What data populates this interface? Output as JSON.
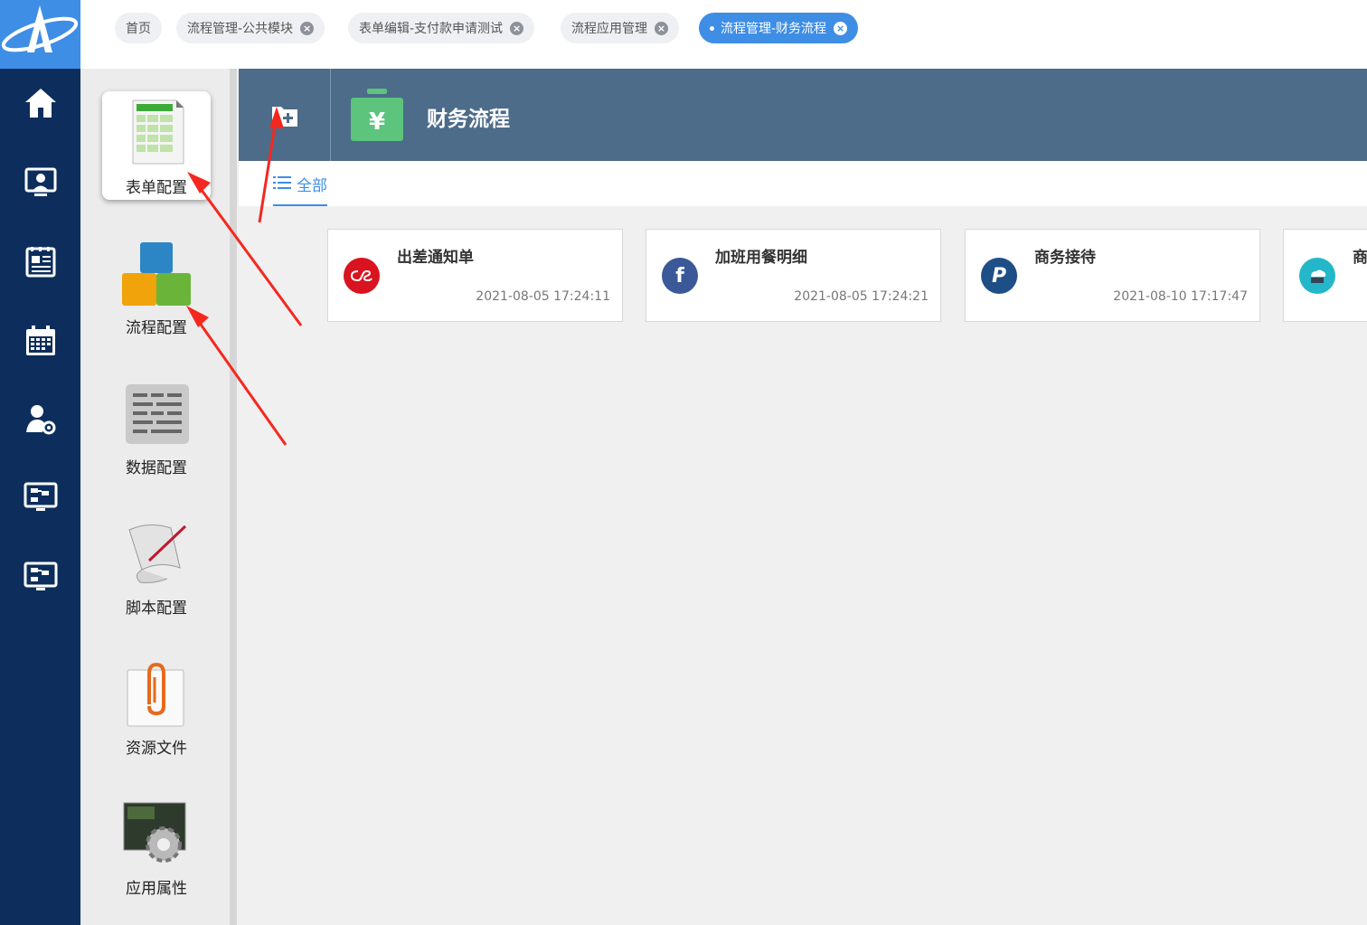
{
  "tabs": [
    {
      "label": "首页",
      "closable": false
    },
    {
      "label": "流程管理-公共模块",
      "closable": true
    },
    {
      "label": "表单编辑-支付款申请测试",
      "closable": true
    },
    {
      "label": "流程应用管理",
      "closable": true
    },
    {
      "label": "流程管理-财务流程",
      "closable": true,
      "active": true
    }
  ],
  "nav_icons": [
    "home-icon",
    "user-screen-icon",
    "newspaper-icon",
    "calendar-icon",
    "user-settings-icon",
    "monitor-flow-icon",
    "monitor-flow-icon"
  ],
  "config_items": [
    {
      "label": "表单配置",
      "icon": "form-sheet-icon",
      "active": true
    },
    {
      "label": "流程配置",
      "icon": "blocks-icon"
    },
    {
      "label": "数据配置",
      "icon": "data-list-icon"
    },
    {
      "label": "脚本配置",
      "icon": "script-scroll-icon"
    },
    {
      "label": "资源文件",
      "icon": "paperclip-file-icon"
    },
    {
      "label": "应用属性",
      "icon": "gear-screen-icon"
    }
  ],
  "header": {
    "category_title": "财务流程",
    "category_icon": "yen-box-icon"
  },
  "filter": {
    "all_label": "全部"
  },
  "cards": [
    {
      "title": "出差通知单",
      "time": "2021-08-05 17:24:11",
      "icon": "lastfm-icon",
      "color": "#d9131f"
    },
    {
      "title": "加班用餐明细",
      "time": "2021-08-05 17:24:21",
      "icon": "facebook-icon",
      "color": "#3b5998"
    },
    {
      "title": "商务接待",
      "time": "2021-08-10 17:17:47",
      "icon": "paypal-icon",
      "color": "#1d4e86"
    },
    {
      "title": "商",
      "time": "",
      "icon": "cloud-icon",
      "color": "#23b7c9"
    }
  ],
  "colors": {
    "rail": "#0d2e5c",
    "accent": "#3f8ee5",
    "header": "#4c6c8a",
    "arrow": "#f5281f"
  }
}
